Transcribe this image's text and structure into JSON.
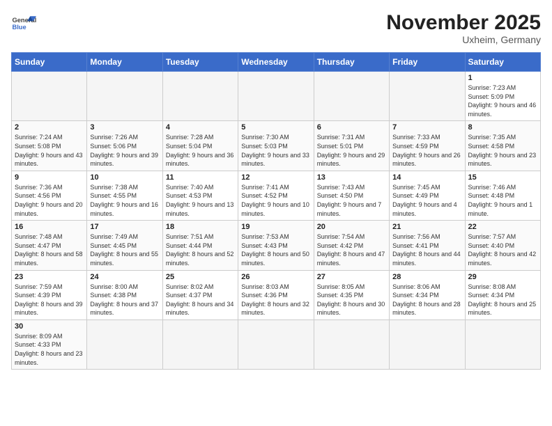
{
  "header": {
    "logo_general": "General",
    "logo_blue": "Blue",
    "month_year": "November 2025",
    "location": "Uxheim, Germany"
  },
  "weekdays": [
    "Sunday",
    "Monday",
    "Tuesday",
    "Wednesday",
    "Thursday",
    "Friday",
    "Saturday"
  ],
  "weeks": [
    [
      {
        "day": "",
        "info": ""
      },
      {
        "day": "",
        "info": ""
      },
      {
        "day": "",
        "info": ""
      },
      {
        "day": "",
        "info": ""
      },
      {
        "day": "",
        "info": ""
      },
      {
        "day": "",
        "info": ""
      },
      {
        "day": "1",
        "info": "Sunrise: 7:23 AM\nSunset: 5:09 PM\nDaylight: 9 hours and 46 minutes."
      }
    ],
    [
      {
        "day": "2",
        "info": "Sunrise: 7:24 AM\nSunset: 5:08 PM\nDaylight: 9 hours and 43 minutes."
      },
      {
        "day": "3",
        "info": "Sunrise: 7:26 AM\nSunset: 5:06 PM\nDaylight: 9 hours and 39 minutes."
      },
      {
        "day": "4",
        "info": "Sunrise: 7:28 AM\nSunset: 5:04 PM\nDaylight: 9 hours and 36 minutes."
      },
      {
        "day": "5",
        "info": "Sunrise: 7:30 AM\nSunset: 5:03 PM\nDaylight: 9 hours and 33 minutes."
      },
      {
        "day": "6",
        "info": "Sunrise: 7:31 AM\nSunset: 5:01 PM\nDaylight: 9 hours and 29 minutes."
      },
      {
        "day": "7",
        "info": "Sunrise: 7:33 AM\nSunset: 4:59 PM\nDaylight: 9 hours and 26 minutes."
      },
      {
        "day": "8",
        "info": "Sunrise: 7:35 AM\nSunset: 4:58 PM\nDaylight: 9 hours and 23 minutes."
      }
    ],
    [
      {
        "day": "9",
        "info": "Sunrise: 7:36 AM\nSunset: 4:56 PM\nDaylight: 9 hours and 20 minutes."
      },
      {
        "day": "10",
        "info": "Sunrise: 7:38 AM\nSunset: 4:55 PM\nDaylight: 9 hours and 16 minutes."
      },
      {
        "day": "11",
        "info": "Sunrise: 7:40 AM\nSunset: 4:53 PM\nDaylight: 9 hours and 13 minutes."
      },
      {
        "day": "12",
        "info": "Sunrise: 7:41 AM\nSunset: 4:52 PM\nDaylight: 9 hours and 10 minutes."
      },
      {
        "day": "13",
        "info": "Sunrise: 7:43 AM\nSunset: 4:50 PM\nDaylight: 9 hours and 7 minutes."
      },
      {
        "day": "14",
        "info": "Sunrise: 7:45 AM\nSunset: 4:49 PM\nDaylight: 9 hours and 4 minutes."
      },
      {
        "day": "15",
        "info": "Sunrise: 7:46 AM\nSunset: 4:48 PM\nDaylight: 9 hours and 1 minute."
      }
    ],
    [
      {
        "day": "16",
        "info": "Sunrise: 7:48 AM\nSunset: 4:47 PM\nDaylight: 8 hours and 58 minutes."
      },
      {
        "day": "17",
        "info": "Sunrise: 7:49 AM\nSunset: 4:45 PM\nDaylight: 8 hours and 55 minutes."
      },
      {
        "day": "18",
        "info": "Sunrise: 7:51 AM\nSunset: 4:44 PM\nDaylight: 8 hours and 52 minutes."
      },
      {
        "day": "19",
        "info": "Sunrise: 7:53 AM\nSunset: 4:43 PM\nDaylight: 8 hours and 50 minutes."
      },
      {
        "day": "20",
        "info": "Sunrise: 7:54 AM\nSunset: 4:42 PM\nDaylight: 8 hours and 47 minutes."
      },
      {
        "day": "21",
        "info": "Sunrise: 7:56 AM\nSunset: 4:41 PM\nDaylight: 8 hours and 44 minutes."
      },
      {
        "day": "22",
        "info": "Sunrise: 7:57 AM\nSunset: 4:40 PM\nDaylight: 8 hours and 42 minutes."
      }
    ],
    [
      {
        "day": "23",
        "info": "Sunrise: 7:59 AM\nSunset: 4:39 PM\nDaylight: 8 hours and 39 minutes."
      },
      {
        "day": "24",
        "info": "Sunrise: 8:00 AM\nSunset: 4:38 PM\nDaylight: 8 hours and 37 minutes."
      },
      {
        "day": "25",
        "info": "Sunrise: 8:02 AM\nSunset: 4:37 PM\nDaylight: 8 hours and 34 minutes."
      },
      {
        "day": "26",
        "info": "Sunrise: 8:03 AM\nSunset: 4:36 PM\nDaylight: 8 hours and 32 minutes."
      },
      {
        "day": "27",
        "info": "Sunrise: 8:05 AM\nSunset: 4:35 PM\nDaylight: 8 hours and 30 minutes."
      },
      {
        "day": "28",
        "info": "Sunrise: 8:06 AM\nSunset: 4:34 PM\nDaylight: 8 hours and 28 minutes."
      },
      {
        "day": "29",
        "info": "Sunrise: 8:08 AM\nSunset: 4:34 PM\nDaylight: 8 hours and 25 minutes."
      }
    ],
    [
      {
        "day": "30",
        "info": "Sunrise: 8:09 AM\nSunset: 4:33 PM\nDaylight: 8 hours and 23 minutes."
      },
      {
        "day": "",
        "info": ""
      },
      {
        "day": "",
        "info": ""
      },
      {
        "day": "",
        "info": ""
      },
      {
        "day": "",
        "info": ""
      },
      {
        "day": "",
        "info": ""
      },
      {
        "day": "",
        "info": ""
      }
    ]
  ]
}
